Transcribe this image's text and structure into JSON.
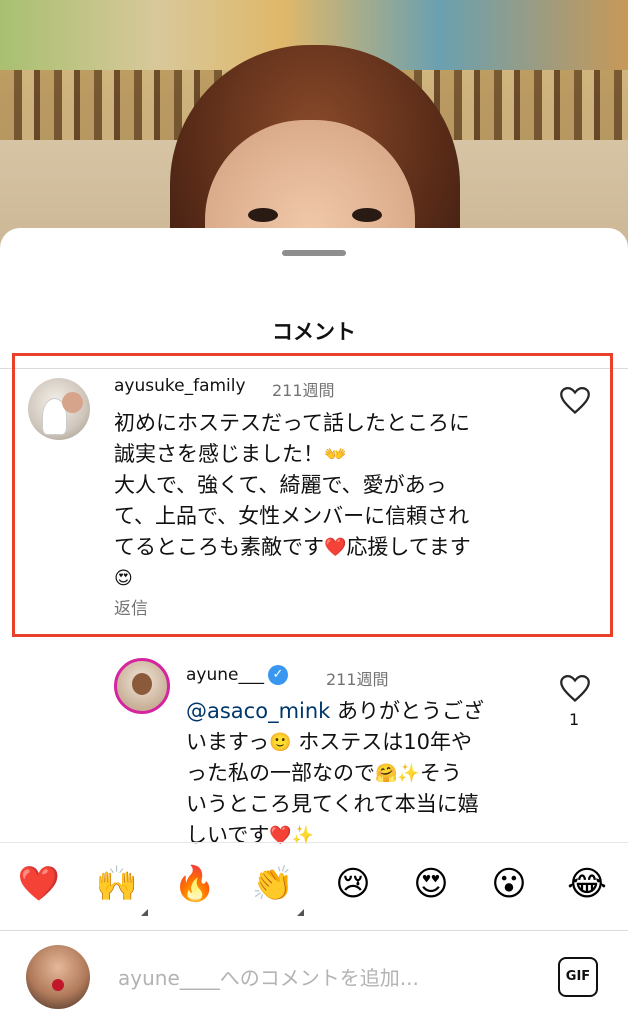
{
  "sheet": {
    "title": "コメント"
  },
  "comment1": {
    "username": "ayusuke_family",
    "time": "211週間",
    "lines": [
      "初めにホステスだって話したところに",
      "誠実さを感じました！",
      "大人で、強くて、綺麗で、愛があっ",
      "て、上品で、女性メンバーに信頼され",
      "てるところも素敵です",
      "応援してます"
    ],
    "reply_label": "返信",
    "emojis": {
      "clap": "👐",
      "heart": "❤️",
      "heart_eyes": "😍"
    }
  },
  "comment2": {
    "username": "ayune___",
    "time": "211週間",
    "mention": "@asaco_mink",
    "lines": [
      " ありがとうござ",
      "いますっ",
      " ホステスは10年や",
      "った私の一部なので",
      "そう",
      "いうところ見てくれて本当に嬉",
      "しいです"
    ],
    "like_count": "1",
    "emojis": {
      "smile": "🙂",
      "hug": "🤗",
      "sparkles": "✨",
      "heart": "❤️"
    }
  },
  "emoji_bar": [
    {
      "name": "heart",
      "glyph": "❤️"
    },
    {
      "name": "raised-hands",
      "glyph": "🙌"
    },
    {
      "name": "fire",
      "glyph": "🔥"
    },
    {
      "name": "clap",
      "glyph": "👏"
    },
    {
      "name": "crying",
      "glyph": "😢"
    },
    {
      "name": "heart-eyes",
      "glyph": "😍"
    },
    {
      "name": "surprised",
      "glyph": "😮"
    },
    {
      "name": "laughing",
      "glyph": "😂"
    }
  ],
  "input": {
    "placeholder": "ayune____へのコメントを追加...",
    "gif_label": "GIF"
  },
  "colors": {
    "highlight": "#e8402a",
    "verified": "#3897f0",
    "mention": "#00376b"
  }
}
